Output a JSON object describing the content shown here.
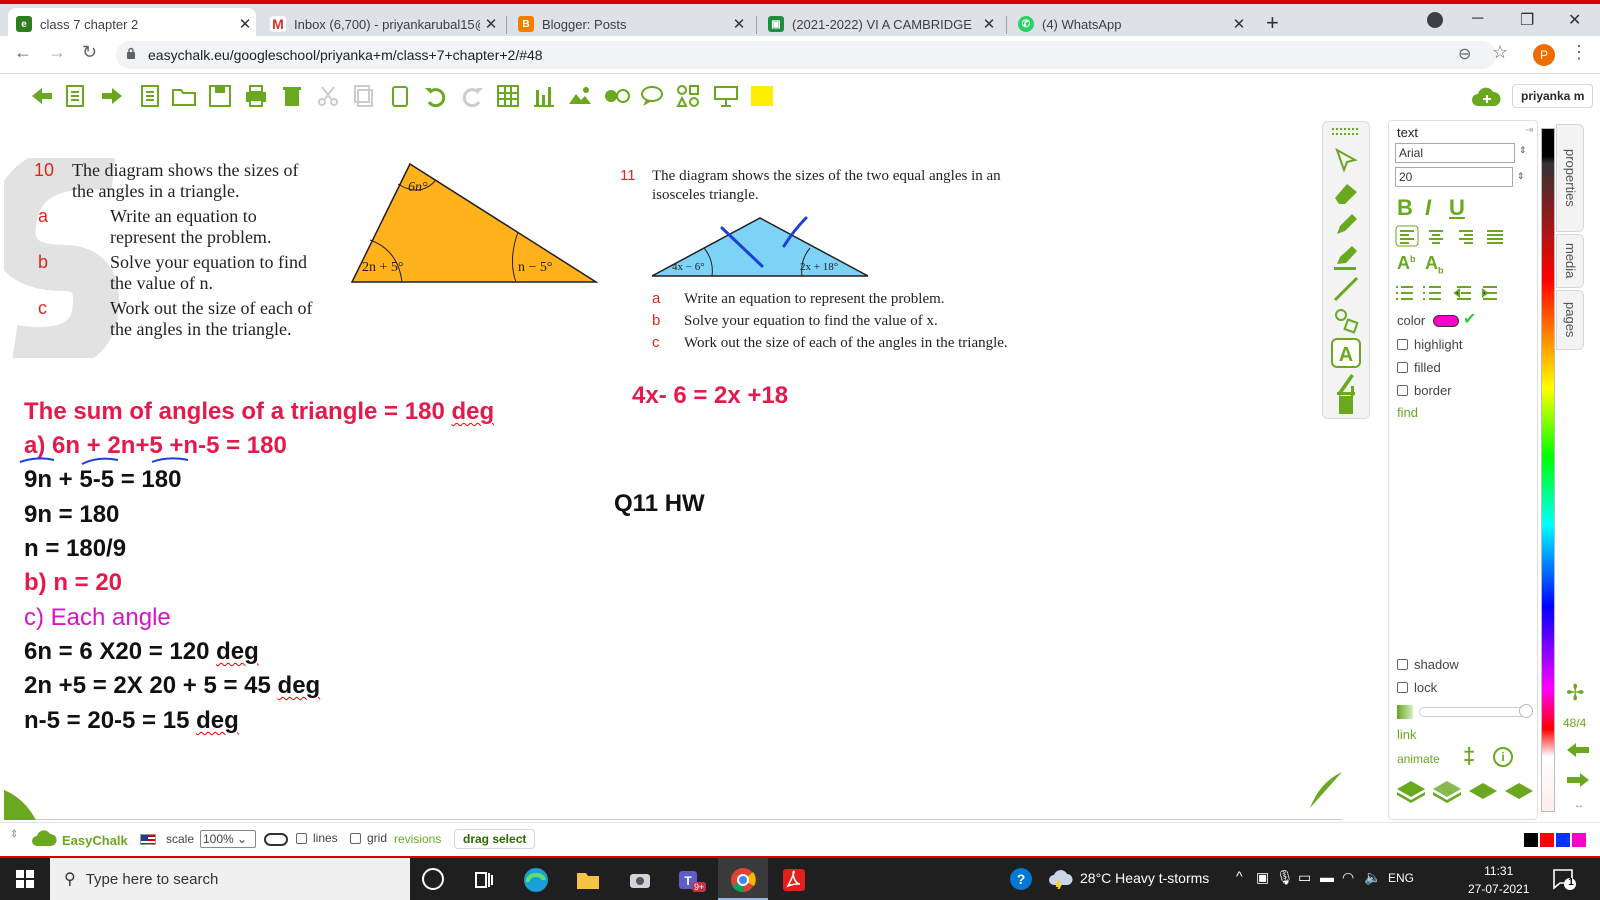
{
  "browser": {
    "tabs": [
      {
        "title": "class 7 chapter 2",
        "favicon": "easychalk",
        "active": true
      },
      {
        "title": "Inbox (6,700) - priyankarubal15@",
        "favicon": "gmail"
      },
      {
        "title": "Blogger: Posts",
        "favicon": "blogger"
      },
      {
        "title": "(2021-2022) VI A CAMBRIDGE",
        "favicon": "classroom"
      },
      {
        "title": "(4) WhatsApp",
        "favicon": "whatsapp"
      }
    ],
    "url": "easychalk.eu/googleschool/priyanka+m/class+7+chapter+2/#48",
    "profile_initial": "P"
  },
  "toolbar": {
    "user": "priyanka m"
  },
  "page": {
    "q10": {
      "number": "10",
      "stem_line1": "The diagram shows the sizes of",
      "stem_line2": "the angles in a triangle.",
      "parts": [
        {
          "letter": "a",
          "l1": "Write an equation to",
          "l2": "represent the problem."
        },
        {
          "letter": "b",
          "l1": "Solve your equation to find",
          "l2": "the value of n."
        },
        {
          "letter": "c",
          "l1": "Work out the size of each of",
          "l2": "the angles in the triangle."
        }
      ],
      "angle_top": "6n°",
      "angle_left": "2n + 5°",
      "angle_right": "n − 5°"
    },
    "q11": {
      "number": "11",
      "stem_line1": "The diagram shows the sizes of the two equal angles in an",
      "stem_line2": "isosceles triangle.",
      "parts": [
        {
          "letter": "a",
          "text": "Write an equation to represent the problem."
        },
        {
          "letter": "b",
          "text": "Solve your equation to find the value of x."
        },
        {
          "letter": "c",
          "text": "Work out the size of each of the angles in the triangle."
        }
      ],
      "angle_left": "4x − 6°",
      "angle_right": "2x + 18°"
    },
    "work": {
      "l1": "The sum of angles of a triangle = 180 deg",
      "l2": "a) 6n + 2n+5 +n-5 = 180",
      "l3": "9n + 5-5 = 180",
      "l4": "9n = 180",
      "l5": "n = 180/9",
      "l6": "b) n = 20",
      "l7": "c) Each angle",
      "l8": "6n  = 6 X20 = 120 deg",
      "l9": "2n +5 = 2X 20 + 5 = 45 deg",
      "l10": "n-5 = 20-5 = 15 deg",
      "q11_eq": "4x- 6 = 2x +18",
      "q11_hw": "Q11 HW"
    }
  },
  "properties": {
    "header": "text",
    "font": "Arial",
    "size": "20",
    "color_label": "color",
    "color_value": "#ff00c8",
    "highlight": "highlight",
    "filled": "filled",
    "border": "border",
    "find": "find",
    "shadow": "shadow",
    "lock": "lock",
    "link": "link",
    "animate": "animate"
  },
  "sidetabs": [
    "properties",
    "media",
    "pages"
  ],
  "page_count": "48/4",
  "bottombar": {
    "brand": "EasyChalk",
    "scale_label": "scale",
    "scale_value": "100%",
    "lines": "lines",
    "grid": "grid",
    "revisions": "revisions",
    "drag_select": "drag select"
  },
  "taskbar": {
    "search_placeholder": "Type here to search",
    "teams_badge": "9+",
    "weather": "28°C  Heavy t-storms",
    "lang": "ENG",
    "time": "11:31",
    "date": "27-07-2021",
    "notif_count": "1"
  },
  "colors": {
    "accent_green": "#6aa820",
    "answer_red": "#e6194b",
    "triangle_orange": "#ffb21c",
    "triangle_blue": "#7dd3f5"
  }
}
